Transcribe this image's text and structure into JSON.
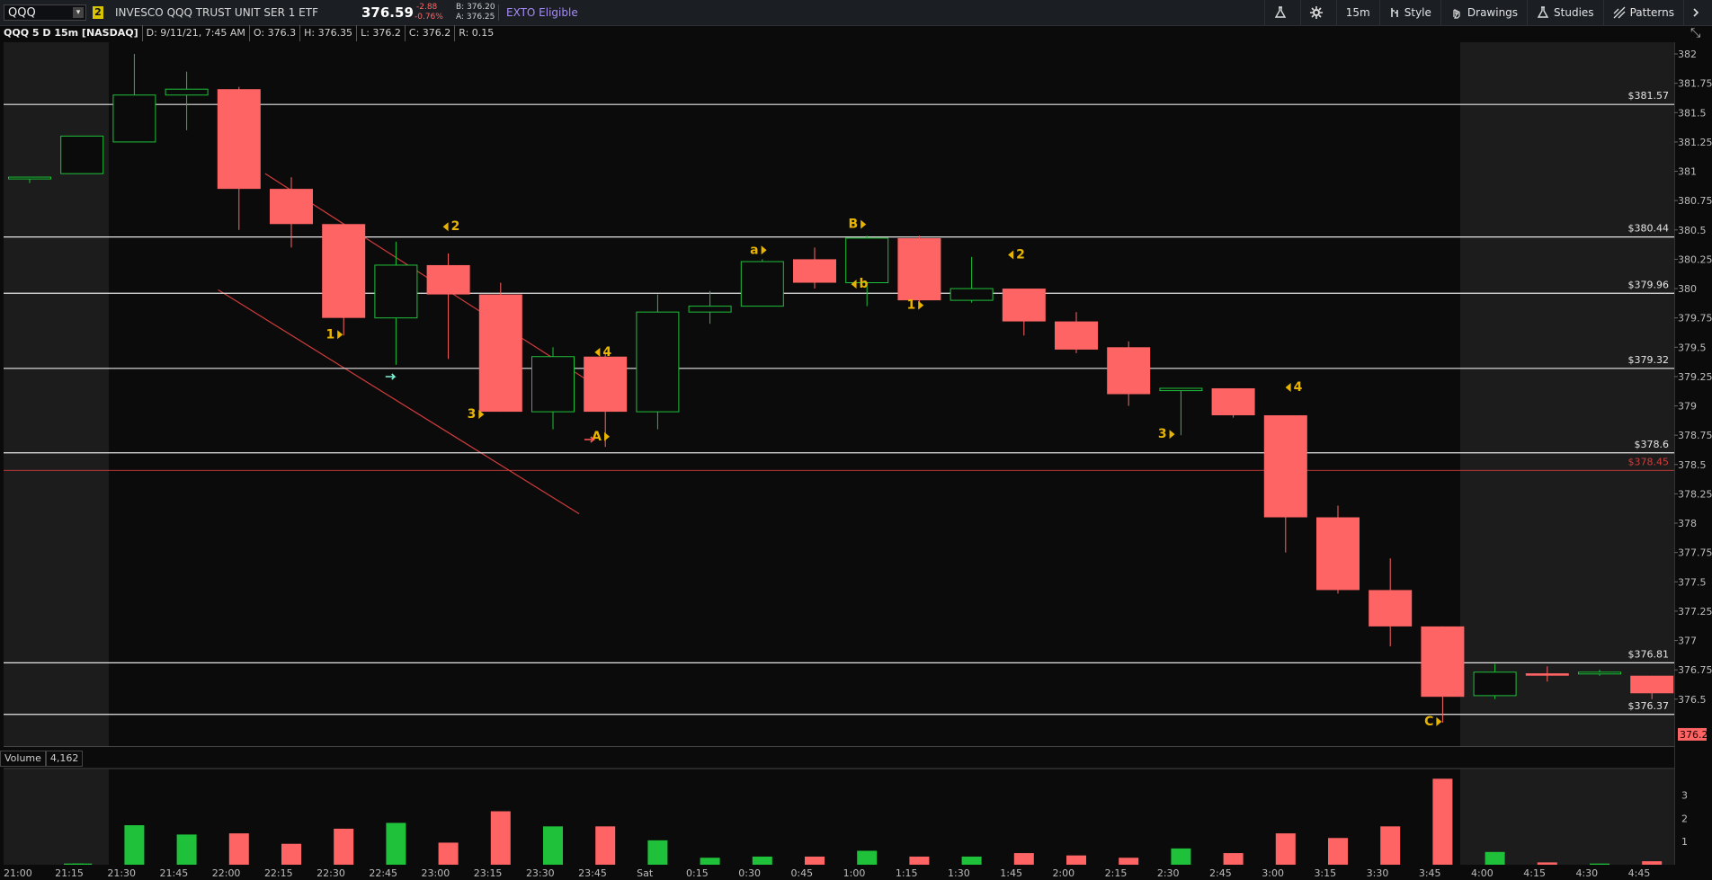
{
  "topbar": {
    "symbol": "QQQ",
    "link_badge": "2",
    "description": "INVESCO QQQ TRUST UNIT SER 1 ETF",
    "last": "376.59",
    "change": "-2.88",
    "change_pct": "-0.76%",
    "bid": "B: 376.20",
    "ask": "A: 376.25",
    "exto": "EXTO Eligible",
    "tools": {
      "timeframe": "15m",
      "style": "Style",
      "drawings": "Drawings",
      "studies": "Studies",
      "patterns": "Patterns"
    }
  },
  "infobar": {
    "title": "QQQ 5 D 15m [NASDAQ]",
    "date": "D: 9/11/21, 7:45 AM",
    "open": "O: 376.3",
    "high": "H: 376.35",
    "low": "L: 376.2",
    "close": "C: 376.2",
    "range": "R: 0.15"
  },
  "volume_panel": {
    "label": "Volume",
    "value": "4,162"
  },
  "colors": {
    "up": "#1fc03a",
    "down": "#ff6464",
    "level_line": "#e6e6e6",
    "trend_line": "#d23c3c",
    "annotation": "#e8b400",
    "background": "#0b0b0b",
    "session_shade": "#1c1c1c"
  },
  "chart_data": {
    "type": "candlestick",
    "timeframe": "15m",
    "ylim": [
      376.1,
      382.1
    ],
    "y_ticks": [
      382,
      381.75,
      381.5,
      381.25,
      381,
      380.75,
      380.5,
      380.25,
      380,
      379.75,
      379.5,
      379.25,
      379,
      378.75,
      378.5,
      378.25,
      378,
      377.75,
      377.5,
      377.25,
      377,
      376.75,
      376.5
    ],
    "x_labels": [
      "21:00",
      "21:15",
      "21:30",
      "21:45",
      "22:00",
      "22:15",
      "22:30",
      "22:45",
      "23:00",
      "23:15",
      "23:30",
      "23:45",
      "Sat",
      "0:15",
      "0:30",
      "0:45",
      "1:00",
      "1:15",
      "1:30",
      "1:45",
      "2:00",
      "2:15",
      "2:30",
      "2:45",
      "3:00",
      "3:15",
      "3:30",
      "3:45",
      "4:00",
      "4:15",
      "4:30",
      "4:45"
    ],
    "candles": [
      {
        "t": "21:15",
        "o": 380.95,
        "h": 380.95,
        "l": 380.9,
        "c": 380.95
      },
      {
        "t": "21:15b",
        "o": 380.98,
        "h": 381.3,
        "l": 380.98,
        "c": 381.3
      },
      {
        "t": "21:30",
        "o": 381.25,
        "h": 382.0,
        "l": 381.25,
        "c": 381.65
      },
      {
        "t": "21:45",
        "o": 381.65,
        "h": 381.85,
        "l": 381.35,
        "c": 381.7
      },
      {
        "t": "22:00",
        "o": 381.7,
        "h": 381.72,
        "l": 380.5,
        "c": 380.85
      },
      {
        "t": "22:15",
        "o": 380.85,
        "h": 380.95,
        "l": 380.35,
        "c": 380.55
      },
      {
        "t": "22:30",
        "o": 380.55,
        "h": 380.55,
        "l": 379.6,
        "c": 379.75
      },
      {
        "t": "22:45",
        "o": 379.75,
        "h": 380.4,
        "l": 379.35,
        "c": 380.2
      },
      {
        "t": "23:00",
        "o": 380.2,
        "h": 380.3,
        "l": 379.4,
        "c": 379.95
      },
      {
        "t": "23:15",
        "o": 379.95,
        "h": 380.05,
        "l": 378.95,
        "c": 378.95
      },
      {
        "t": "23:30",
        "o": 378.95,
        "h": 379.5,
        "l": 378.8,
        "c": 379.42
      },
      {
        "t": "23:45",
        "o": 379.42,
        "h": 379.45,
        "l": 378.65,
        "c": 378.95
      },
      {
        "t": "Sat",
        "o": 378.95,
        "h": 379.95,
        "l": 378.8,
        "c": 379.8
      },
      {
        "t": "0:15",
        "o": 379.8,
        "h": 379.98,
        "l": 379.7,
        "c": 379.85
      },
      {
        "t": "0:30",
        "o": 379.85,
        "h": 380.25,
        "l": 379.85,
        "c": 380.23
      },
      {
        "t": "0:45",
        "o": 380.25,
        "h": 380.35,
        "l": 380.0,
        "c": 380.05
      },
      {
        "t": "1:00",
        "o": 380.05,
        "h": 380.45,
        "l": 379.85,
        "c": 380.43
      },
      {
        "t": "1:15",
        "o": 380.43,
        "h": 380.45,
        "l": 379.85,
        "c": 379.9
      },
      {
        "t": "1:30",
        "o": 379.9,
        "h": 380.27,
        "l": 379.88,
        "c": 380.0
      },
      {
        "t": "1:45",
        "o": 380.0,
        "h": 380.0,
        "l": 379.6,
        "c": 379.72
      },
      {
        "t": "2:00",
        "o": 379.72,
        "h": 379.8,
        "l": 379.45,
        "c": 379.48
      },
      {
        "t": "2:15",
        "o": 379.5,
        "h": 379.55,
        "l": 379.0,
        "c": 379.1
      },
      {
        "t": "2:30",
        "o": 379.13,
        "h": 379.15,
        "l": 378.75,
        "c": 379.15
      },
      {
        "t": "2:45",
        "o": 379.15,
        "h": 379.15,
        "l": 378.9,
        "c": 378.92
      },
      {
        "t": "3:00",
        "o": 378.92,
        "h": 378.92,
        "l": 377.75,
        "c": 378.05
      },
      {
        "t": "3:15",
        "o": 378.05,
        "h": 378.15,
        "l": 377.4,
        "c": 377.43
      },
      {
        "t": "3:30",
        "o": 377.43,
        "h": 377.7,
        "l": 376.95,
        "c": 377.12
      },
      {
        "t": "3:45",
        "o": 377.12,
        "h": 377.12,
        "l": 376.3,
        "c": 376.52
      },
      {
        "t": "4:00",
        "o": 376.53,
        "h": 376.8,
        "l": 376.5,
        "c": 376.73
      },
      {
        "t": "4:15",
        "o": 376.72,
        "h": 376.78,
        "l": 376.65,
        "c": 376.7
      },
      {
        "t": "4:30",
        "o": 376.72,
        "h": 376.75,
        "l": 376.7,
        "c": 376.73
      },
      {
        "t": "4:45",
        "o": 376.7,
        "h": 376.7,
        "l": 376.5,
        "c": 376.55
      }
    ],
    "volume_ticks": [
      "3",
      "2",
      "1"
    ],
    "volumes": [
      0.05,
      0.05,
      1.7,
      1.3,
      1.35,
      0.9,
      1.55,
      1.8,
      0.95,
      2.3,
      1.65,
      1.65,
      1.05,
      0.3,
      0.35,
      0.35,
      0.6,
      0.35,
      0.35,
      0.5,
      0.4,
      0.3,
      0.7,
      0.5,
      1.35,
      1.15,
      1.65,
      3.7,
      0.55,
      0.1,
      0.05,
      0.15
    ],
    "levels": [
      {
        "label": "$381.57",
        "price": 381.57,
        "color": "#e6e6e6"
      },
      {
        "label": "$380.44",
        "price": 380.44,
        "color": "#e6e6e6"
      },
      {
        "label": "$379.96",
        "price": 379.96,
        "color": "#e6e6e6"
      },
      {
        "label": "$379.32",
        "price": 379.32,
        "color": "#e6e6e6"
      },
      {
        "label": "$378.6",
        "price": 378.6,
        "color": "#e6e6e6"
      },
      {
        "label": "$378.45",
        "price": 378.45,
        "color": "#d23c3c"
      },
      {
        "label": "$376.81",
        "price": 376.81,
        "color": "#e6e6e6"
      },
      {
        "label": "$376.37",
        "price": 376.37,
        "color": "#e6e6e6"
      }
    ],
    "last_price_label": "376.2",
    "annotations": [
      {
        "text": "1",
        "dir": "right",
        "bar": 6,
        "price": 379.6
      },
      {
        "text": "2",
        "dir": "left",
        "bar": 8,
        "price": 380.52
      },
      {
        "text": "3",
        "dir": "right",
        "bar": 8.7,
        "price": 378.92
      },
      {
        "text": "4",
        "dir": "left",
        "bar": 10.9,
        "price": 379.45
      },
      {
        "text": "A",
        "dir": "right",
        "bar": 11.1,
        "price": 378.73
      },
      {
        "text": "a",
        "dir": "right",
        "bar": 14.1,
        "price": 380.32
      },
      {
        "text": "b",
        "dir": "left",
        "bar": 15.8,
        "price": 380.03
      },
      {
        "text": "B",
        "dir": "right",
        "bar": 16,
        "price": 380.54
      },
      {
        "text": "1",
        "dir": "right",
        "bar": 17.1,
        "price": 379.85
      },
      {
        "text": "2",
        "dir": "left",
        "bar": 18.8,
        "price": 380.28
      },
      {
        "text": "3",
        "dir": "right",
        "bar": 21.9,
        "price": 378.75
      },
      {
        "text": "4",
        "dir": "left",
        "bar": 24.1,
        "price": 379.15
      },
      {
        "text": "C",
        "dir": "right",
        "bar": 27,
        "price": 376.3
      }
    ]
  }
}
